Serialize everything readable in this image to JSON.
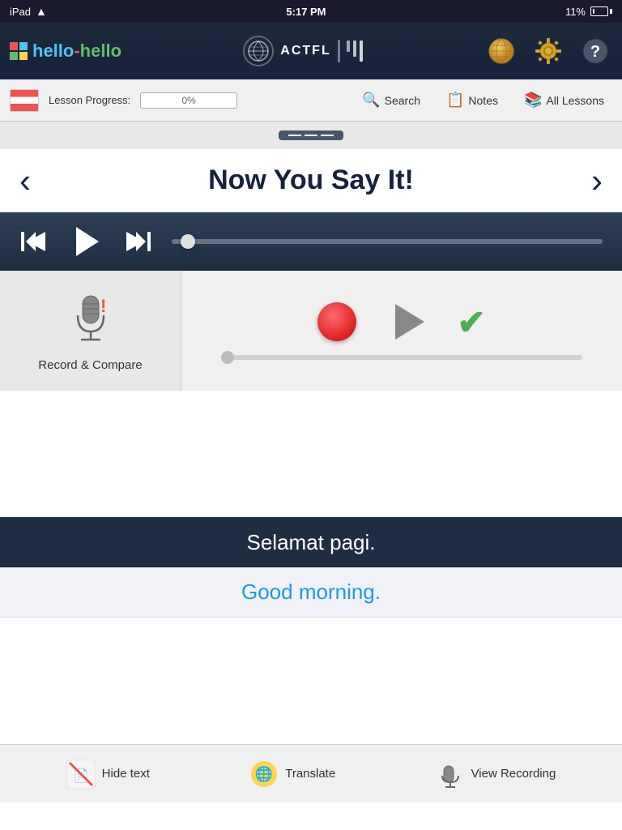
{
  "statusBar": {
    "device": "iPad",
    "wifi": "wifi",
    "time": "5:17 PM",
    "battery": "11%"
  },
  "header": {
    "logoText1": "hello",
    "logoDash": "-",
    "logoText2": "hello",
    "actflLabel": "ACTFL",
    "icons": [
      "globe-icon",
      "settings-icon",
      "help-icon"
    ]
  },
  "toolbar": {
    "flagAlt": "flag",
    "lessonProgressLabel": "Lesson Progress:",
    "progressValue": "0%",
    "searchLabel": "Search",
    "notesLabel": "Notes",
    "allLessonsLabel": "All Lessons"
  },
  "mainTitle": "Now You Say It!",
  "player": {
    "skipBackLabel": "skip-back",
    "playLabel": "play",
    "skipFwdLabel": "skip-forward"
  },
  "recordCompare": {
    "label": "Record & Compare",
    "recordBtn": "record",
    "playBtn": "play-recording",
    "checkBtn": "accept"
  },
  "phrases": {
    "main": "Selamat pagi.",
    "translation": "Good morning."
  },
  "bottomToolbar": {
    "hideTextLabel": "Hide text",
    "translateLabel": "Translate",
    "viewRecordingLabel": "View Recording"
  }
}
